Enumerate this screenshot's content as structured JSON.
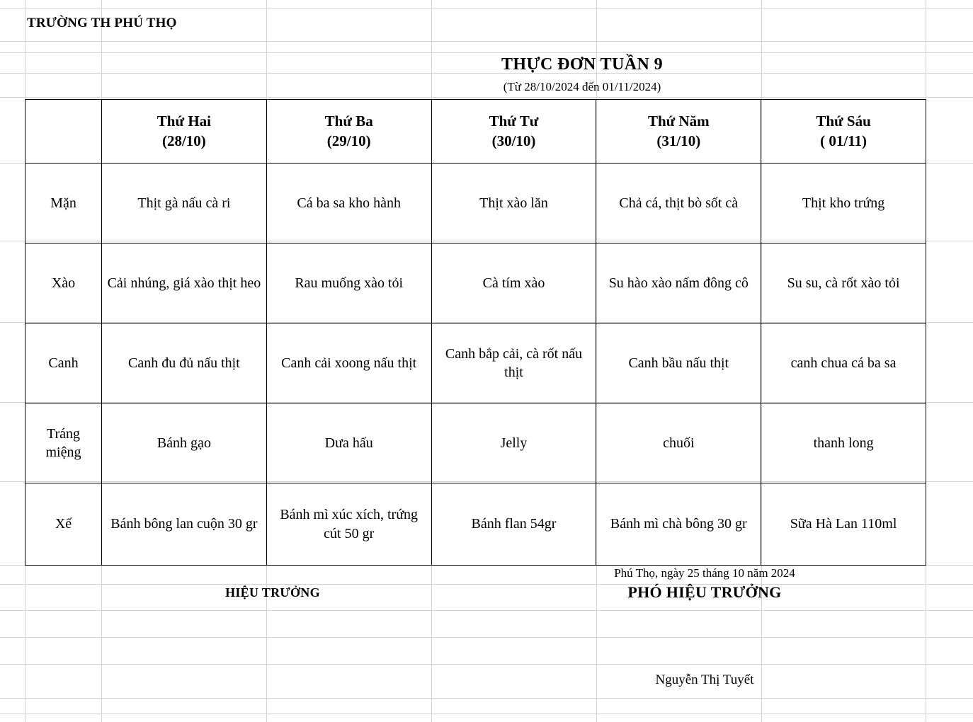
{
  "header": {
    "school_name": "TRƯỜNG TH PHÚ THỌ",
    "title": "THỰC ĐƠN TUẦN 9",
    "subtitle": "(Từ 28/10/2024 đến 01/11/2024)"
  },
  "table": {
    "corner_label": "",
    "columns": [
      {
        "day": "Thứ Hai",
        "date": "(28/10)"
      },
      {
        "day": "Thứ Ba",
        "date": "(29/10)"
      },
      {
        "day": "Thứ Tư",
        "date": "(30/10)"
      },
      {
        "day": "Thứ Năm",
        "date": "(31/10)"
      },
      {
        "day": "Thứ Sáu",
        "date": "( 01/11)"
      }
    ],
    "rows": [
      {
        "label": "Mặn",
        "cells": [
          "Thịt gà nấu cà ri",
          "Cá ba sa kho hành",
          "Thịt xào lăn",
          "Chả cá, thịt bò sốt cà",
          "Thịt kho trứng"
        ]
      },
      {
        "label": "Xào",
        "cells": [
          "Cải nhúng, giá xào thịt heo",
          "Rau muống xào tỏi",
          "Cà tím xào",
          "Su hào xào nấm đông cô",
          "Su su, cà rốt xào tỏi"
        ]
      },
      {
        "label": "Canh",
        "cells": [
          "Canh đu đủ nấu thịt",
          "Canh cải xoong nấu thịt",
          "Canh bắp cải, cà rốt nấu thịt",
          "Canh bầu nấu thịt",
          "canh chua cá ba sa"
        ]
      },
      {
        "label": "Tráng miệng",
        "cells": [
          "Bánh gạo",
          "Dưa hấu",
          "Jelly",
          "chuối",
          "thanh long"
        ]
      },
      {
        "label": "Xế",
        "cells": [
          "Bánh bông lan cuộn 30 gr",
          "Bánh mì xúc xích, trứng cút 50 gr",
          "Bánh flan 54gr",
          "Bánh mì chà bông 30 gr",
          "Sữa Hà Lan 110ml"
        ]
      }
    ]
  },
  "footer": {
    "place_date": "Phú Thọ, ngày 25 tháng 10 năm 2024",
    "principal_title": "HIỆU TRƯỞNG",
    "vice_principal_title": "PHÓ HIỆU TRƯỞNG",
    "signer_name": "Nguyễn Thị Tuyết"
  },
  "colors": {
    "gridline": "#d4d4d4",
    "border": "#000000",
    "text": "#000000",
    "background": "#ffffff"
  }
}
